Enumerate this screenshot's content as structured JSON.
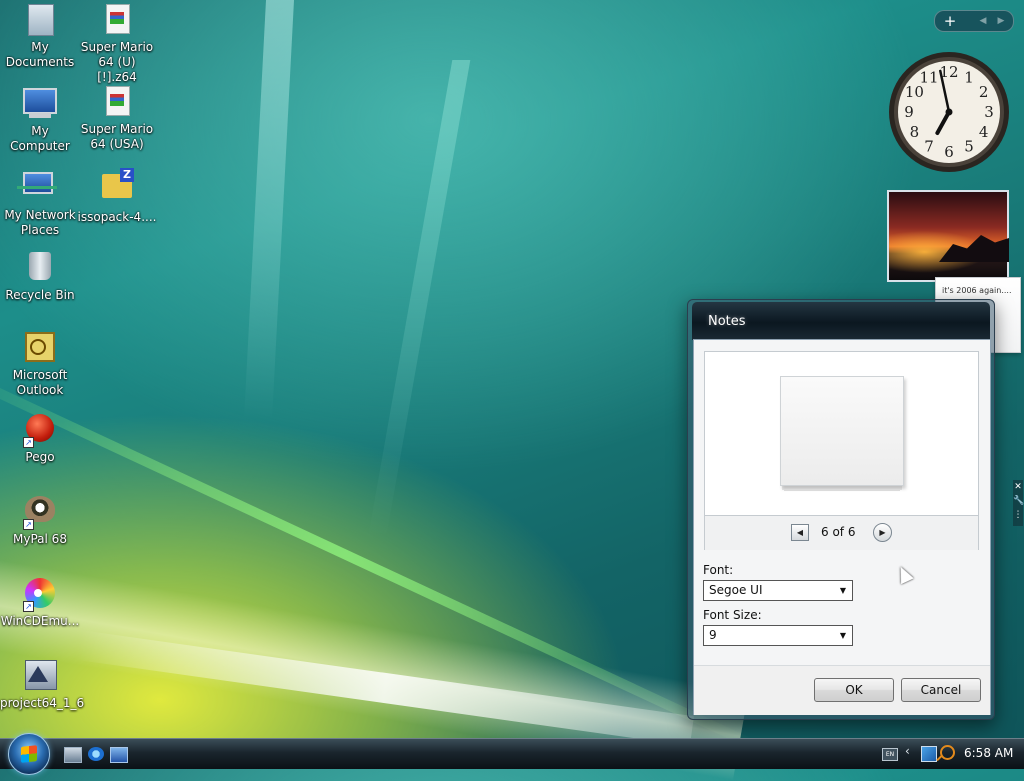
{
  "desktop": {
    "icons": [
      {
        "label": "My Documents",
        "icon": "my-documents-icon"
      },
      {
        "label": "Super Mario 64 (U) [!].z64",
        "icon": "rom-file-icon"
      },
      {
        "label": "My Computer",
        "icon": "computer-icon"
      },
      {
        "label": "Super Mario 64 (USA)",
        "icon": "rom-file-icon"
      },
      {
        "label": "My Network Places",
        "icon": "network-icon"
      },
      {
        "label": "issopack-4....",
        "icon": "zip-folder-icon"
      },
      {
        "label": "Recycle Bin",
        "icon": "recycle-bin-icon"
      },
      {
        "label": "Microsoft Outlook",
        "icon": "outlook-icon"
      },
      {
        "label": "Pego",
        "icon": "pego-icon"
      },
      {
        "label": "MyPal 68",
        "icon": "mypal-icon"
      },
      {
        "label": "WinCDEmu...",
        "icon": "disc-icon"
      },
      {
        "label": "project64_1_6",
        "icon": "project64-icon"
      }
    ]
  },
  "sidebar": {
    "add_label": "+",
    "prev_label": "◀",
    "next_label": "▶",
    "clock": {
      "hour": 6,
      "minute": 58
    },
    "sticky_note_text": "it's 2006 again....",
    "tools": {
      "close": "✕",
      "settings": "🔧",
      "drag": "⋮"
    }
  },
  "notes_dialog": {
    "title": "Notes",
    "pager": {
      "prev": "◀",
      "count": "6 of 6",
      "next": "▶"
    },
    "font_label": "Font:",
    "font_value": "Segoe UI",
    "font_size_label": "Font Size:",
    "font_size_value": "9",
    "dropdown_arrow": "▼",
    "ok_label": "OK",
    "cancel_label": "Cancel"
  },
  "taskbar": {
    "keyboard_label": "EN",
    "chevron": "‹",
    "time": "6:58 AM"
  },
  "colors": {
    "desktop_teal": "#1d8e8a",
    "desktop_yellow": "#ebf03c",
    "taskbar": "#1a252d",
    "dialog_title": "#0b1720"
  }
}
